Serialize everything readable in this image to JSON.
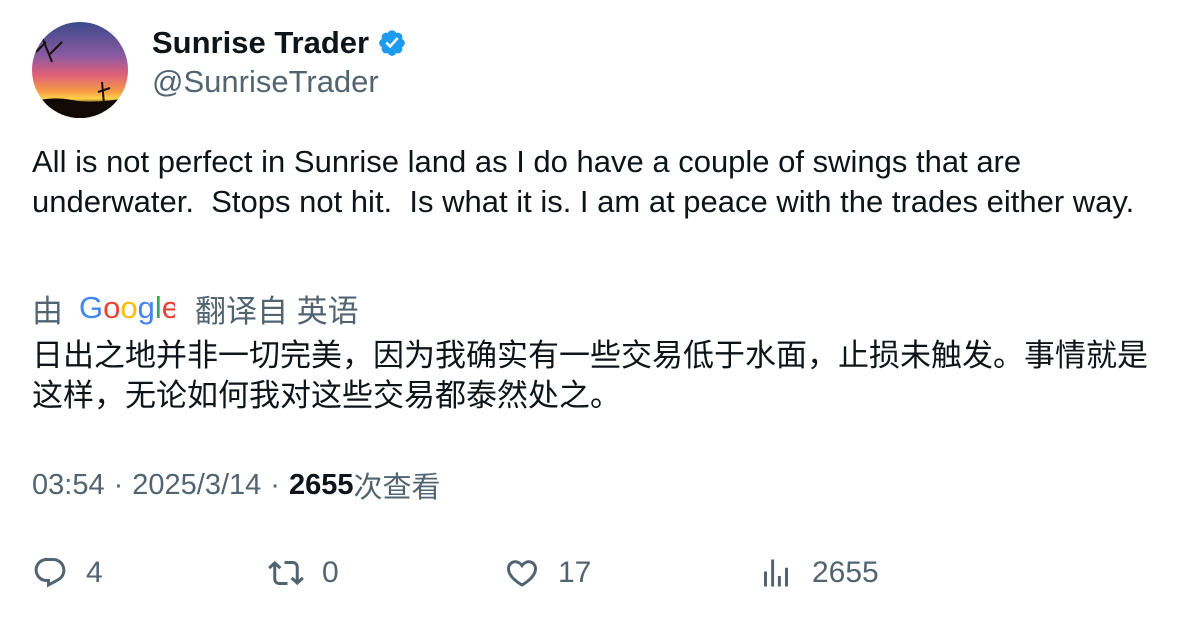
{
  "author": {
    "display_name": "Sunrise Trader",
    "handle": "@SunriseTrader",
    "verified": true
  },
  "tweet": {
    "text": "All is not perfect in Sunrise land as I do have a couple of swings that are underwater.  Stops not hit.  Is what it is. I am at peace with the trades either way."
  },
  "translation": {
    "by_label": "由",
    "provider": "Google",
    "source_label": "翻译自 英语",
    "text": "日出之地并非一切完美，因为我确实有一些交易低于水面，止损未触发。事情就是这样，无论如何我对这些交易都泰然处之。"
  },
  "meta": {
    "time": "03:54",
    "separator": "·",
    "date": "2025/3/14",
    "views_count": "2655",
    "views_label": "次查看"
  },
  "actions": {
    "replies": "4",
    "reposts": "0",
    "likes": "17",
    "views": "2655"
  },
  "colors": {
    "text": "#0f1419",
    "secondary": "#536471",
    "verified": "#1d9bf0"
  },
  "icons": [
    "verified-badge-icon",
    "reply-icon",
    "repost-icon",
    "like-icon",
    "views-icon"
  ]
}
